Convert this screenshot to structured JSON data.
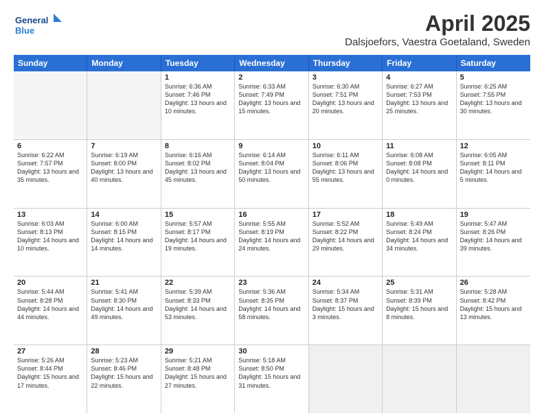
{
  "logo": {
    "line1": "General",
    "line2": "Blue"
  },
  "title": "April 2025",
  "subtitle": "Dalsjoefors, Vaestra Goetaland, Sweden",
  "days": [
    "Sunday",
    "Monday",
    "Tuesday",
    "Wednesday",
    "Thursday",
    "Friday",
    "Saturday"
  ],
  "weeks": [
    [
      {
        "day": "",
        "info": ""
      },
      {
        "day": "",
        "info": ""
      },
      {
        "day": "1",
        "info": "Sunrise: 6:36 AM\nSunset: 7:46 PM\nDaylight: 13 hours and 10 minutes."
      },
      {
        "day": "2",
        "info": "Sunrise: 6:33 AM\nSunset: 7:49 PM\nDaylight: 13 hours and 15 minutes."
      },
      {
        "day": "3",
        "info": "Sunrise: 6:30 AM\nSunset: 7:51 PM\nDaylight: 13 hours and 20 minutes."
      },
      {
        "day": "4",
        "info": "Sunrise: 6:27 AM\nSunset: 7:53 PM\nDaylight: 13 hours and 25 minutes."
      },
      {
        "day": "5",
        "info": "Sunrise: 6:25 AM\nSunset: 7:55 PM\nDaylight: 13 hours and 30 minutes."
      }
    ],
    [
      {
        "day": "6",
        "info": "Sunrise: 6:22 AM\nSunset: 7:57 PM\nDaylight: 13 hours and 35 minutes."
      },
      {
        "day": "7",
        "info": "Sunrise: 6:19 AM\nSunset: 8:00 PM\nDaylight: 13 hours and 40 minutes."
      },
      {
        "day": "8",
        "info": "Sunrise: 6:16 AM\nSunset: 8:02 PM\nDaylight: 13 hours and 45 minutes."
      },
      {
        "day": "9",
        "info": "Sunrise: 6:14 AM\nSunset: 8:04 PM\nDaylight: 13 hours and 50 minutes."
      },
      {
        "day": "10",
        "info": "Sunrise: 6:11 AM\nSunset: 8:06 PM\nDaylight: 13 hours and 55 minutes."
      },
      {
        "day": "11",
        "info": "Sunrise: 6:08 AM\nSunset: 8:08 PM\nDaylight: 14 hours and 0 minutes."
      },
      {
        "day": "12",
        "info": "Sunrise: 6:05 AM\nSunset: 8:11 PM\nDaylight: 14 hours and 5 minutes."
      }
    ],
    [
      {
        "day": "13",
        "info": "Sunrise: 6:03 AM\nSunset: 8:13 PM\nDaylight: 14 hours and 10 minutes."
      },
      {
        "day": "14",
        "info": "Sunrise: 6:00 AM\nSunset: 8:15 PM\nDaylight: 14 hours and 14 minutes."
      },
      {
        "day": "15",
        "info": "Sunrise: 5:57 AM\nSunset: 8:17 PM\nDaylight: 14 hours and 19 minutes."
      },
      {
        "day": "16",
        "info": "Sunrise: 5:55 AM\nSunset: 8:19 PM\nDaylight: 14 hours and 24 minutes."
      },
      {
        "day": "17",
        "info": "Sunrise: 5:52 AM\nSunset: 8:22 PM\nDaylight: 14 hours and 29 minutes."
      },
      {
        "day": "18",
        "info": "Sunrise: 5:49 AM\nSunset: 8:24 PM\nDaylight: 14 hours and 34 minutes."
      },
      {
        "day": "19",
        "info": "Sunrise: 5:47 AM\nSunset: 8:26 PM\nDaylight: 14 hours and 39 minutes."
      }
    ],
    [
      {
        "day": "20",
        "info": "Sunrise: 5:44 AM\nSunset: 8:28 PM\nDaylight: 14 hours and 44 minutes."
      },
      {
        "day": "21",
        "info": "Sunrise: 5:41 AM\nSunset: 8:30 PM\nDaylight: 14 hours and 49 minutes."
      },
      {
        "day": "22",
        "info": "Sunrise: 5:39 AM\nSunset: 8:33 PM\nDaylight: 14 hours and 53 minutes."
      },
      {
        "day": "23",
        "info": "Sunrise: 5:36 AM\nSunset: 8:35 PM\nDaylight: 14 hours and 58 minutes."
      },
      {
        "day": "24",
        "info": "Sunrise: 5:34 AM\nSunset: 8:37 PM\nDaylight: 15 hours and 3 minutes."
      },
      {
        "day": "25",
        "info": "Sunrise: 5:31 AM\nSunset: 8:39 PM\nDaylight: 15 hours and 8 minutes."
      },
      {
        "day": "26",
        "info": "Sunrise: 5:28 AM\nSunset: 8:42 PM\nDaylight: 15 hours and 13 minutes."
      }
    ],
    [
      {
        "day": "27",
        "info": "Sunrise: 5:26 AM\nSunset: 8:44 PM\nDaylight: 15 hours and 17 minutes."
      },
      {
        "day": "28",
        "info": "Sunrise: 5:23 AM\nSunset: 8:46 PM\nDaylight: 15 hours and 22 minutes."
      },
      {
        "day": "29",
        "info": "Sunrise: 5:21 AM\nSunset: 8:48 PM\nDaylight: 15 hours and 27 minutes."
      },
      {
        "day": "30",
        "info": "Sunrise: 5:18 AM\nSunset: 8:50 PM\nDaylight: 15 hours and 31 minutes."
      },
      {
        "day": "",
        "info": ""
      },
      {
        "day": "",
        "info": ""
      },
      {
        "day": "",
        "info": ""
      }
    ]
  ]
}
